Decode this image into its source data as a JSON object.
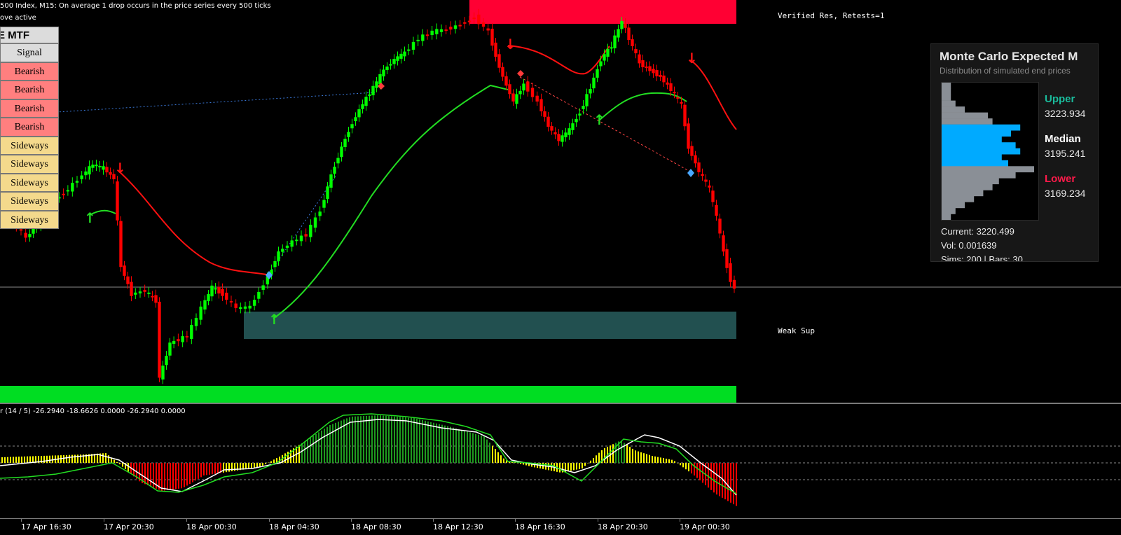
{
  "header": {
    "info_line": "500 Index, M15:  On average 1 drop occurs in the price series every 500 ticks",
    "status_line": "ove active"
  },
  "colors": {
    "bull": "#00ff00",
    "bear": "#ff0000",
    "resistance_zone": "#ff0033",
    "weak_support_zone": "#225050",
    "strong_support_zone": "#00dd22",
    "ma_upper": "#ff1111",
    "ma_lower": "#22dd22",
    "osc_bear": "#ff0000",
    "osc_bull": "#1f9a1f",
    "osc_neutral": "#ffff00"
  },
  "zones": {
    "resistance_label": "Verified Res, Retests=1",
    "support_label": "Weak Sup"
  },
  "mtf_table": {
    "title": "E MTF",
    "header": "Signal",
    "rows": [
      {
        "signal": "Bearish",
        "color": "#ff7f7f"
      },
      {
        "signal": "Bearish",
        "color": "#ff7f7f"
      },
      {
        "signal": "Bearish",
        "color": "#ff7f7f"
      },
      {
        "signal": "Bearish",
        "color": "#ff7f7f"
      },
      {
        "signal": "Sideways",
        "color": "#f4d98c"
      },
      {
        "signal": "Sideways",
        "color": "#f4d98c"
      },
      {
        "signal": "Sideways",
        "color": "#f4d98c"
      },
      {
        "signal": "Sideways",
        "color": "#f4d98c"
      },
      {
        "signal": "Sideways",
        "color": "#f4d98c"
      }
    ]
  },
  "monte_carlo": {
    "title": "Monte Carlo Expected M",
    "subtitle": "Distribution of simulated end prices",
    "upper": {
      "label": "Upper",
      "value": "3223.934",
      "color": "#1abc9c"
    },
    "median": {
      "label": "Median",
      "value": "3195.241",
      "color": "#ffffff"
    },
    "lower": {
      "label": "Lower",
      "value": "3169.234",
      "color": "#ff1a4a"
    },
    "current": "Current: 3220.499",
    "vol": "Vol: 0.001639",
    "sims": "Sims: 200 | Bars: 30",
    "histogram": [
      {
        "v": 0.1,
        "zone": "upper"
      },
      {
        "v": 0.1,
        "zone": "upper"
      },
      {
        "v": 0.1,
        "zone": "upper"
      },
      {
        "v": 0.15,
        "zone": "upper"
      },
      {
        "v": 0.25,
        "zone": "upper"
      },
      {
        "v": 0.5,
        "zone": "upper"
      },
      {
        "v": 0.55,
        "zone": "upper"
      },
      {
        "v": 0.85,
        "zone": "median"
      },
      {
        "v": 0.75,
        "zone": "median"
      },
      {
        "v": 0.65,
        "zone": "median"
      },
      {
        "v": 0.8,
        "zone": "median"
      },
      {
        "v": 0.85,
        "zone": "median"
      },
      {
        "v": 0.65,
        "zone": "median"
      },
      {
        "v": 0.72,
        "zone": "median"
      },
      {
        "v": 1.0,
        "zone": "lower"
      },
      {
        "v": 0.8,
        "zone": "lower"
      },
      {
        "v": 0.62,
        "zone": "lower"
      },
      {
        "v": 0.55,
        "zone": "lower"
      },
      {
        "v": 0.45,
        "zone": "lower"
      },
      {
        "v": 0.35,
        "zone": "lower"
      },
      {
        "v": 0.25,
        "zone": "lower"
      },
      {
        "v": 0.15,
        "zone": "lower"
      },
      {
        "v": 0.1,
        "zone": "lower"
      }
    ]
  },
  "oscillator": {
    "label": "r (14 / 5) -26.2940 -18.6626 0.0000 -26.2940 0.0000"
  },
  "x_axis": {
    "ticks": [
      "17 Apr 16:30",
      "17 Apr 20:30",
      "18 Apr 00:30",
      "18 Apr 04:30",
      "18 Apr 08:30",
      "18 Apr 12:30",
      "18 Apr 16:30",
      "18 Apr 20:30",
      "19 Apr 00:30"
    ]
  }
}
